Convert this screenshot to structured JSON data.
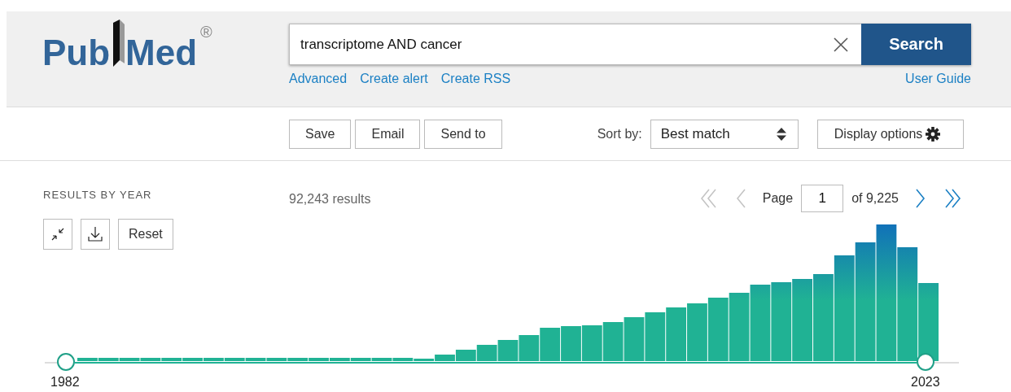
{
  "header": {
    "logo": {
      "parts": [
        "Pub",
        "Med"
      ],
      "mark": "®"
    },
    "search": {
      "value": "transcriptome AND cancer",
      "button": "Search"
    },
    "links": [
      "Advanced",
      "Create alert",
      "Create RSS"
    ],
    "user_guide": "User Guide"
  },
  "toolbar": {
    "actions": [
      "Save",
      "Email",
      "Send to"
    ],
    "sort_label": "Sort by:",
    "sort_value": "Best match",
    "display_options": "Display options"
  },
  "results": {
    "section_title": "RESULTS BY YEAR",
    "reset": "Reset",
    "count": "92,243 results",
    "pagination": {
      "page_label": "Page",
      "page": "1",
      "of": "of 9,225",
      "controls": [
        {
          "kind": "first",
          "disabled": true
        },
        {
          "kind": "prev",
          "disabled": true
        },
        {
          "kind": "next",
          "disabled": false
        },
        {
          "kind": "last",
          "disabled": false
        }
      ]
    },
    "timeline": {
      "start": "1982",
      "end": "2023"
    }
  }
}
